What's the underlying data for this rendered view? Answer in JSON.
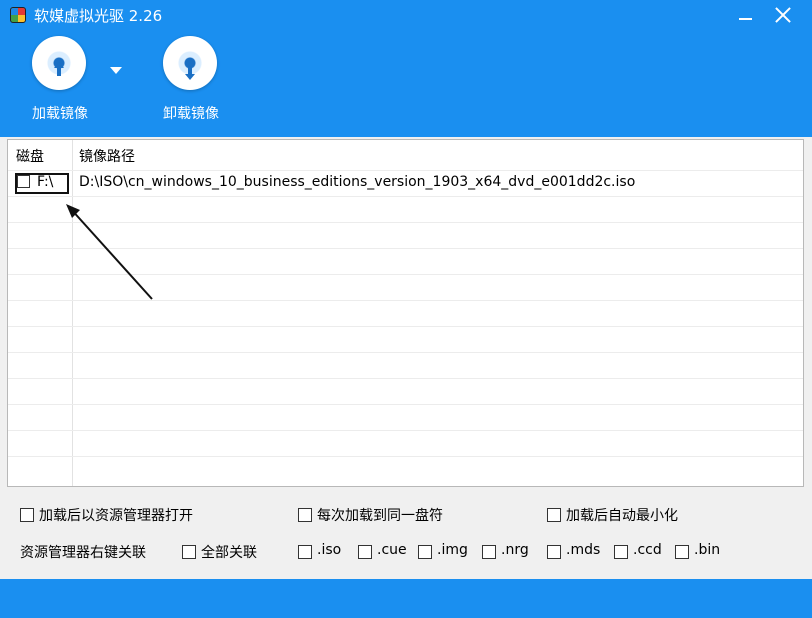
{
  "window": {
    "title": "软媒虚拟光驱 2.26",
    "accent_color": "#1a8ff0",
    "app_icon": "app-logo-icon",
    "minimize_icon": "minimize-icon",
    "close_icon": "close-icon"
  },
  "toolbar": {
    "mount": {
      "label": "加载镜像",
      "icon": "disc-mount-icon"
    },
    "unmount": {
      "label": "卸载镜像",
      "icon": "disc-eject-icon"
    },
    "dropdown_icon": "chevron-down-icon"
  },
  "list": {
    "columns": [
      "磁盘",
      "镜像路径"
    ],
    "rows": [
      {
        "drive": "F:\\",
        "path": "D:\\ISO\\cn_windows_10_business_editions_version_1903_x64_dvd_e001dd2c.iso",
        "checked": false
      }
    ]
  },
  "options": {
    "open_explorer": {
      "label": "加载后以资源管理器打开",
      "checked": false
    },
    "same_drive": {
      "label": "每次加载到同一盘符",
      "checked": false
    },
    "auto_minimize": {
      "label": "加载后自动最小化",
      "checked": false
    },
    "assoc_label": "资源管理器右键关联",
    "all_assoc": {
      "label": "全部关联",
      "checked": false
    },
    "extensions": [
      {
        "label": ".iso",
        "checked": false
      },
      {
        "label": ".cue",
        "checked": false
      },
      {
        "label": ".img",
        "checked": false
      },
      {
        "label": ".nrg",
        "checked": false
      },
      {
        "label": ".mds",
        "checked": false
      },
      {
        "label": ".ccd",
        "checked": false
      },
      {
        "label": ".bin",
        "checked": false
      }
    ]
  }
}
